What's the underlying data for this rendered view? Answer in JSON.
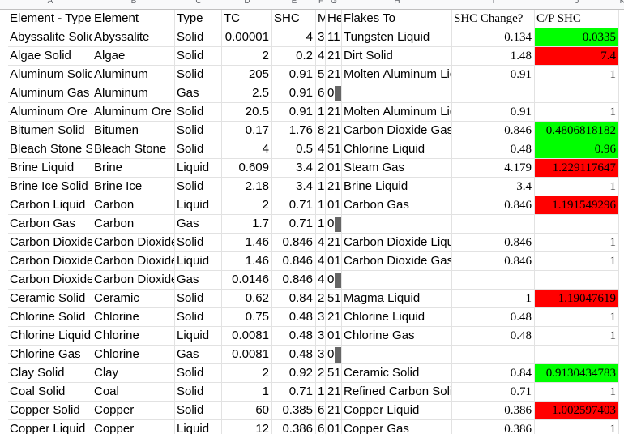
{
  "column_letters": [
    "A",
    "B",
    "C",
    "D",
    "E",
    "F",
    "G",
    "H",
    "I",
    "J",
    "K"
  ],
  "header": {
    "element_type": "Element - Type",
    "element": "Element",
    "type": "Type",
    "tc": "TC",
    "shc": "SHC",
    "m": "M",
    "h": "He",
    "flakes_to": "Flakes To",
    "shc_change": "SHC Change?",
    "cp_shc": "C/P SHC"
  },
  "colors": {
    "high": "#00ff00",
    "low": "#ff0000",
    "empty_marker": "#666666"
  },
  "rows": [
    {
      "element_type": "Abyssalite Solid",
      "element": "Abyssalite",
      "type": "Solid",
      "tc": "0.00001",
      "shc": "4",
      "m": "3",
      "h": "11",
      "flakes_to": "Tungsten Liquid",
      "shc_change": "0.134",
      "cp_shc": "0.0335",
      "highlight": "green"
    },
    {
      "element_type": "Algae Solid",
      "element": "Algae",
      "type": "Solid",
      "tc": "2",
      "shc": "0.2",
      "m": "4",
      "h": "21",
      "flakes_to": "Dirt Solid",
      "shc_change": "1.48",
      "cp_shc": "7.4",
      "highlight": "red"
    },
    {
      "element_type": "Aluminum Solid",
      "element": "Aluminum",
      "type": "Solid",
      "tc": "205",
      "shc": "0.91",
      "m": "5",
      "h": "21",
      "flakes_to": "Molten Aluminum Liquid",
      "shc_change": "0.91",
      "cp_shc": "1",
      "highlight": ""
    },
    {
      "element_type": "Aluminum Gas",
      "element": "Aluminum",
      "type": "Gas",
      "tc": "2.5",
      "shc": "0.91",
      "m": "6",
      "h": "00",
      "flakes_to": "",
      "shc_change": "",
      "cp_shc": "",
      "highlight": "",
      "empty": true
    },
    {
      "element_type": "Aluminum Ore Solid",
      "element": "Aluminum Ore",
      "type": "Solid",
      "tc": "20.5",
      "shc": "0.91",
      "m": "1",
      "h": "21",
      "flakes_to": "Molten Aluminum Liquid",
      "shc_change": "0.91",
      "cp_shc": "1",
      "highlight": ""
    },
    {
      "element_type": "Bitumen Solid",
      "element": "Bitumen",
      "type": "Solid",
      "tc": "0.17",
      "shc": "1.76",
      "m": "8",
      "h": "21",
      "flakes_to": "Carbon Dioxide Gas",
      "shc_change": "0.846",
      "cp_shc": "0.4806818182",
      "highlight": "green"
    },
    {
      "element_type": "Bleach Stone Solid",
      "element": "Bleach Stone",
      "type": "Solid",
      "tc": "4",
      "shc": "0.5",
      "m": "4",
      "h": "51",
      "flakes_to": "Chlorine Liquid",
      "shc_change": "0.48",
      "cp_shc": "0.96",
      "highlight": "green"
    },
    {
      "element_type": "Brine Liquid",
      "element": "Brine",
      "type": "Liquid",
      "tc": "0.609",
      "shc": "3.4",
      "m": "2",
      "h": "01",
      "flakes_to": "Steam Gas",
      "shc_change": "4.179",
      "cp_shc": "1.229117647",
      "highlight": "red"
    },
    {
      "element_type": "Brine Ice Solid",
      "element": "Brine Ice",
      "type": "Solid",
      "tc": "2.18",
      "shc": "3.4",
      "m": "1",
      "h": "21",
      "flakes_to": "Brine Liquid",
      "shc_change": "3.4",
      "cp_shc": "1",
      "highlight": ""
    },
    {
      "element_type": "Carbon Liquid",
      "element": "Carbon",
      "type": "Liquid",
      "tc": "2",
      "shc": "0.71",
      "m": "1",
      "h": "01",
      "flakes_to": "Carbon Gas",
      "shc_change": "0.846",
      "cp_shc": "1.191549296",
      "highlight": "red"
    },
    {
      "element_type": "Carbon Gas",
      "element": "Carbon",
      "type": "Gas",
      "tc": "1.7",
      "shc": "0.71",
      "m": "1",
      "h": "00",
      "flakes_to": "",
      "shc_change": "",
      "cp_shc": "",
      "highlight": "",
      "empty": true
    },
    {
      "element_type": "Carbon Dioxide Solid",
      "element": "Carbon Dioxide",
      "type": "Solid",
      "tc": "1.46",
      "shc": "0.846",
      "m": "4",
      "h": "21",
      "flakes_to": "Carbon Dioxide Liquid",
      "shc_change": "0.846",
      "cp_shc": "1",
      "highlight": ""
    },
    {
      "element_type": "Carbon Dioxide Liquid",
      "element": "Carbon Dioxide",
      "type": "Liquid",
      "tc": "1.46",
      "shc": "0.846",
      "m": "4",
      "h": "01",
      "flakes_to": "Carbon Dioxide Gas",
      "shc_change": "0.846",
      "cp_shc": "1",
      "highlight": ""
    },
    {
      "element_type": "Carbon Dioxide Gas",
      "element": "Carbon Dioxide",
      "type": "Gas",
      "tc": "0.0146",
      "shc": "0.846",
      "m": "4",
      "h": "00",
      "flakes_to": "",
      "shc_change": "",
      "cp_shc": "",
      "highlight": "",
      "empty": true
    },
    {
      "element_type": "Ceramic Solid",
      "element": "Ceramic",
      "type": "Solid",
      "tc": "0.62",
      "shc": "0.84",
      "m": "2",
      "h": "51",
      "flakes_to": "Magma Liquid",
      "shc_change": "1",
      "cp_shc": "1.19047619",
      "highlight": "red"
    },
    {
      "element_type": "Chlorine Solid",
      "element": "Chlorine",
      "type": "Solid",
      "tc": "0.75",
      "shc": "0.48",
      "m": "3",
      "h": "21",
      "flakes_to": "Chlorine Liquid",
      "shc_change": "0.48",
      "cp_shc": "1",
      "highlight": ""
    },
    {
      "element_type": "Chlorine Liquid",
      "element": "Chlorine",
      "type": "Liquid",
      "tc": "0.0081",
      "shc": "0.48",
      "m": "3",
      "h": "01",
      "flakes_to": "Chlorine Gas",
      "shc_change": "0.48",
      "cp_shc": "1",
      "highlight": ""
    },
    {
      "element_type": "Chlorine Gas",
      "element": "Chlorine",
      "type": "Gas",
      "tc": "0.0081",
      "shc": "0.48",
      "m": "3",
      "h": "00",
      "flakes_to": "",
      "shc_change": "",
      "cp_shc": "",
      "highlight": "",
      "empty": true
    },
    {
      "element_type": "Clay Solid",
      "element": "Clay",
      "type": "Solid",
      "tc": "2",
      "shc": "0.92",
      "m": "2",
      "h": "51",
      "flakes_to": "Ceramic Solid",
      "shc_change": "0.84",
      "cp_shc": "0.9130434783",
      "highlight": "green"
    },
    {
      "element_type": "Coal Solid",
      "element": "Coal",
      "type": "Solid",
      "tc": "1",
      "shc": "0.71",
      "m": "1",
      "h": "21",
      "flakes_to": "Refined Carbon Solid",
      "shc_change": "0.71",
      "cp_shc": "1",
      "highlight": ""
    },
    {
      "element_type": "Copper Solid",
      "element": "Copper",
      "type": "Solid",
      "tc": "60",
      "shc": "0.385",
      "m": "6",
      "h": "21",
      "flakes_to": "Copper Liquid",
      "shc_change": "0.386",
      "cp_shc": "1.002597403",
      "highlight": "red"
    },
    {
      "element_type": "Copper Liquid",
      "element": "Copper",
      "type": "Liquid",
      "tc": "12",
      "shc": "0.386",
      "m": "6",
      "h": "01",
      "flakes_to": "Copper Gas",
      "shc_change": "0.386",
      "cp_shc": "1",
      "highlight": ""
    }
  ]
}
